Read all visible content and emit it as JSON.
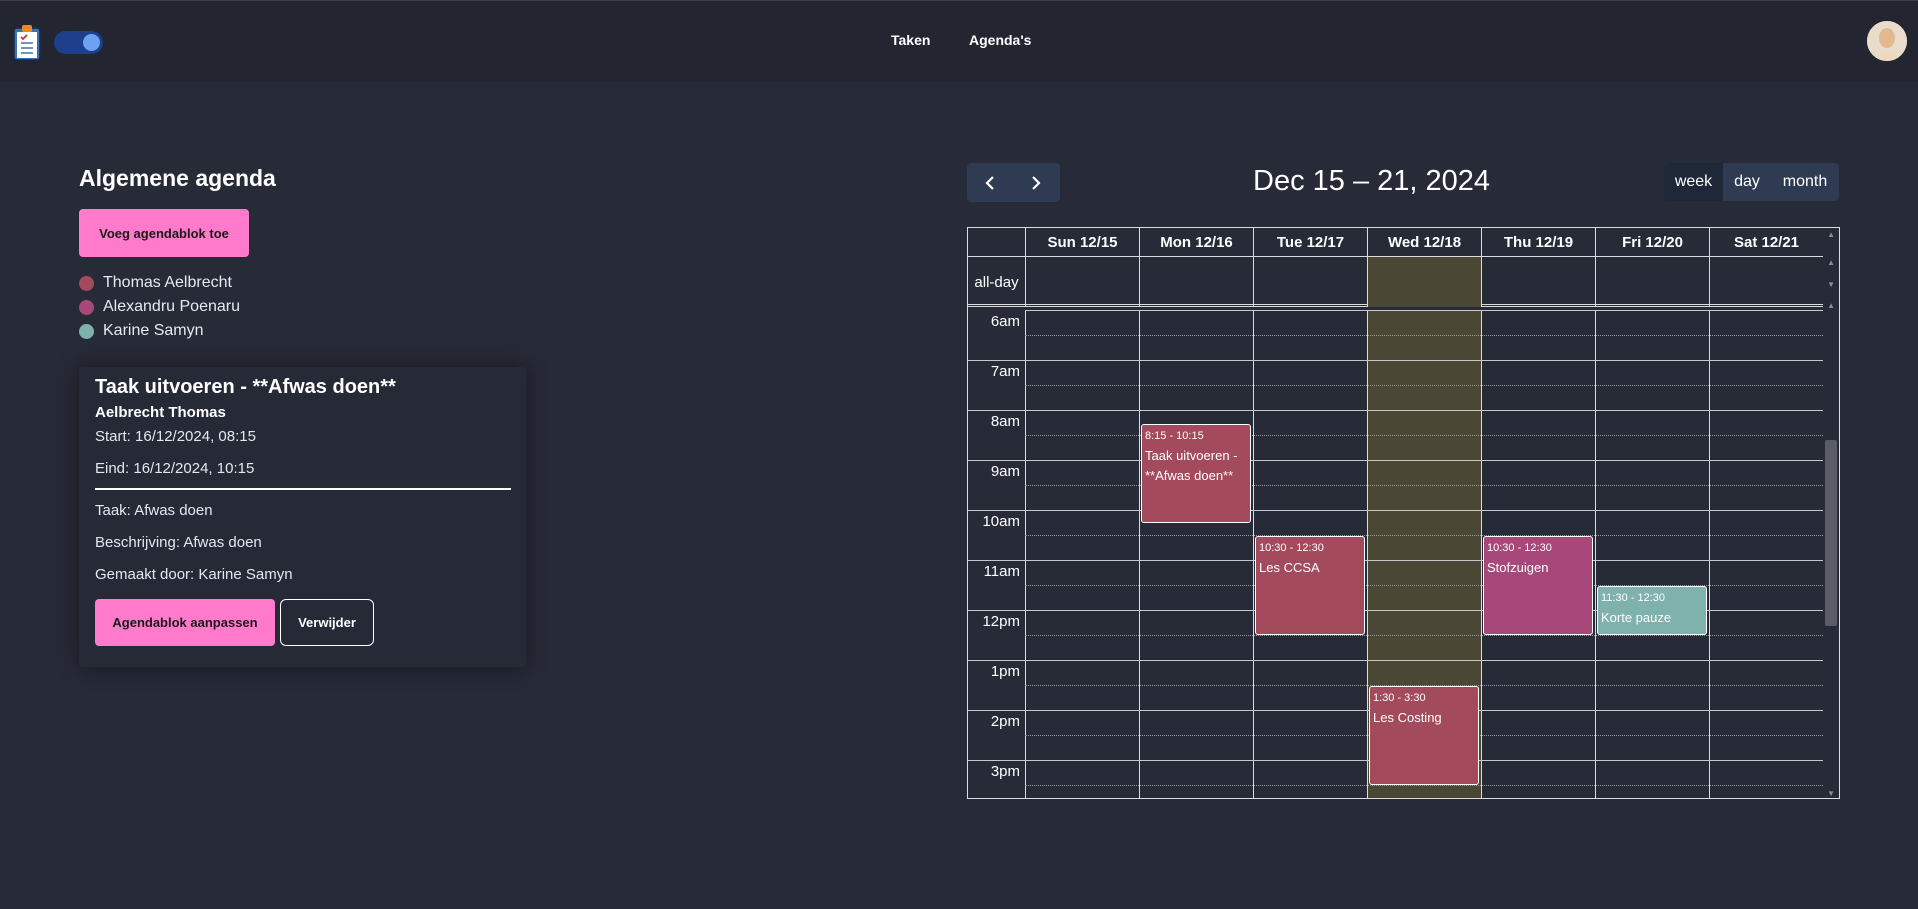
{
  "header": {
    "logo_icon": "clipboard-icon",
    "nav": [
      {
        "label": "Taken"
      },
      {
        "label": "Agenda's"
      }
    ],
    "avatar_icon": "user-avatar-icon",
    "toggle_on": true
  },
  "left": {
    "title": "Algemene agenda",
    "add_button": "Voeg agendablok toe",
    "legend": [
      {
        "name": "Thomas Aelbrecht",
        "color": "#a34a5c"
      },
      {
        "name": "Alexandru Poenaru",
        "color": "#a8487a"
      },
      {
        "name": "Karine Samyn",
        "color": "#7fb2ac"
      }
    ],
    "detail": {
      "title": "Taak uitvoeren - **Afwas doen**",
      "person": "Aelbrecht Thomas",
      "start": "Start: 16/12/2024, 08:15",
      "end": "Eind: 16/12/2024, 10:15",
      "task": "Taak: Afwas doen",
      "description": "Beschrijving: Afwas doen",
      "made_by": "Gemaakt door: Karine Samyn",
      "edit_button": "Agendablok aanpassen",
      "delete_button": "Verwijder"
    }
  },
  "calendar": {
    "title": "Dec 15 – 21, 2024",
    "prev_icon": "chevron-left-icon",
    "next_icon": "chevron-right-icon",
    "views": [
      {
        "label": "week",
        "active": true
      },
      {
        "label": "day",
        "active": false
      },
      {
        "label": "month",
        "active": false
      }
    ],
    "days": [
      "Sun 12/15",
      "Mon 12/16",
      "Tue 12/17",
      "Wed 12/18",
      "Thu 12/19",
      "Fri 12/20",
      "Sat 12/21"
    ],
    "today_index": 3,
    "allday_label": "all-day",
    "hours": [
      "6am",
      "7am",
      "8am",
      "9am",
      "10am",
      "11am",
      "12pm",
      "1pm",
      "2pm",
      "3pm"
    ],
    "events": [
      {
        "day": 1,
        "time": "8:15 - 10:15",
        "title": "Taak uitvoeren - **Afwas doen**",
        "color": "#a34a5c"
      },
      {
        "day": 2,
        "time": "10:30 - 12:30",
        "title": "Les CCSA",
        "color": "#a34a5c"
      },
      {
        "day": 4,
        "time": "10:30 - 12:30",
        "title": "Stofzuigen",
        "color": "#a8487a"
      },
      {
        "day": 5,
        "time": "11:30 - 12:30",
        "title": "Korte pauze",
        "color": "#7fb2ac"
      },
      {
        "day": 3,
        "time": "1:30 - 3:30",
        "title": "Les Costing",
        "color": "#a34a5c"
      }
    ]
  }
}
